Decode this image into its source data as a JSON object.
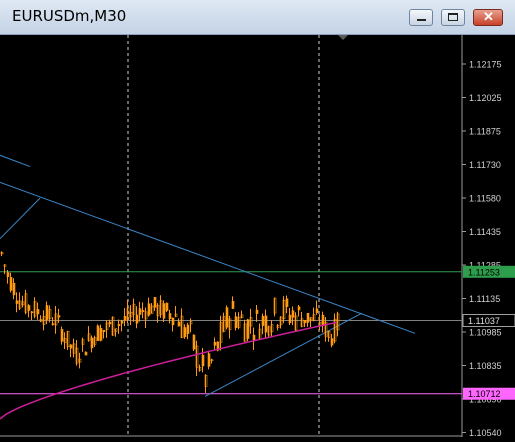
{
  "window": {
    "title": "EURUSDm,M30",
    "buttons": {
      "minimize": "minimize",
      "maximize": "maximize",
      "close": "close"
    },
    "close_glyph": "✕"
  },
  "chart_data": {
    "type": "candlestick",
    "symbol": "EURUSDm",
    "timeframe": "M30",
    "price_axis": {
      "ticks": [
        "1.12175",
        "1.12025",
        "1.11875",
        "1.11730",
        "1.11580",
        "1.11435",
        "1.11285",
        "1.11135",
        "1.10985",
        "1.10835",
        "1.10690",
        "1.10540"
      ],
      "ylim": [
        1.1054,
        1.123
      ]
    },
    "horizontal_lines": [
      {
        "price": 1.11253,
        "label": "1.11253",
        "color": "#2e9e4c"
      },
      {
        "price": 1.10712,
        "label": "1.10712",
        "color": "#ff66ff"
      },
      {
        "price": 1.11037,
        "label": "1.11037",
        "color": "#808080"
      }
    ],
    "series_color": "#ff9a10",
    "moving_average_color": "#cc1f9a",
    "trendline_color": "#3a86c8",
    "grid": "vertical dotted separators",
    "close_start": 1.1122,
    "close_end": 1.1104,
    "low_point": 1.1071
  }
}
